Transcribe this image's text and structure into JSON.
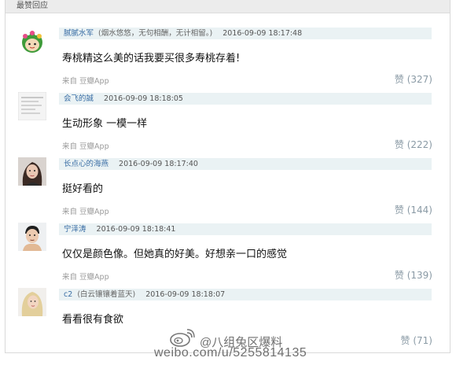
{
  "section": {
    "title": "最赞回应"
  },
  "comments": [
    {
      "user": "腻腻水军",
      "signature": "(烟水悠悠，无句相酬，无计相留。)",
      "time": "2016-09-09 18:17:48",
      "content": "寿桃精这么美的话我要买很多寿桃存着!",
      "from_label": "来自",
      "app": "豆瓣App",
      "like_label": "赞",
      "likes": "(327)",
      "avatar": "cartoon-avatar"
    },
    {
      "user": "会飞的誠",
      "signature": "",
      "time": "2016-09-09 18:18:05",
      "content": "生动形象 一模一样",
      "from_label": "来自",
      "app": "豆瓣App",
      "like_label": "赞",
      "likes": "(222)",
      "avatar": "document-thumbnail-avatar"
    },
    {
      "user": "长点心的海燕",
      "signature": "",
      "time": "2016-09-09 18:17:40",
      "content": "挺好看的",
      "from_label": "来自",
      "app": "豆瓣App",
      "like_label": "赞",
      "likes": "(144)",
      "avatar": "woman-photo-avatar"
    },
    {
      "user": "宁泽涛",
      "signature": "",
      "time": "2016-09-09 18:18:41",
      "content": "仅仅是颜色像。但她真的好美。好想亲一口的感觉",
      "from_label": "来自",
      "app": "豆瓣App",
      "like_label": "赞",
      "likes": "(139)",
      "avatar": "man-photo-avatar"
    },
    {
      "user": "c2",
      "signature": "(白云镶镶着蓝天)",
      "time": "2016-09-09 18:18:07",
      "content": "看看很有食欲",
      "from_label": "",
      "app": "",
      "like_label": "赞",
      "likes": "(71)",
      "avatar": "blonde-woman-photo-avatar"
    }
  ],
  "watermark": {
    "handle": "@八组兔区爆料",
    "url": "weibo.com/u/5255814135"
  }
}
